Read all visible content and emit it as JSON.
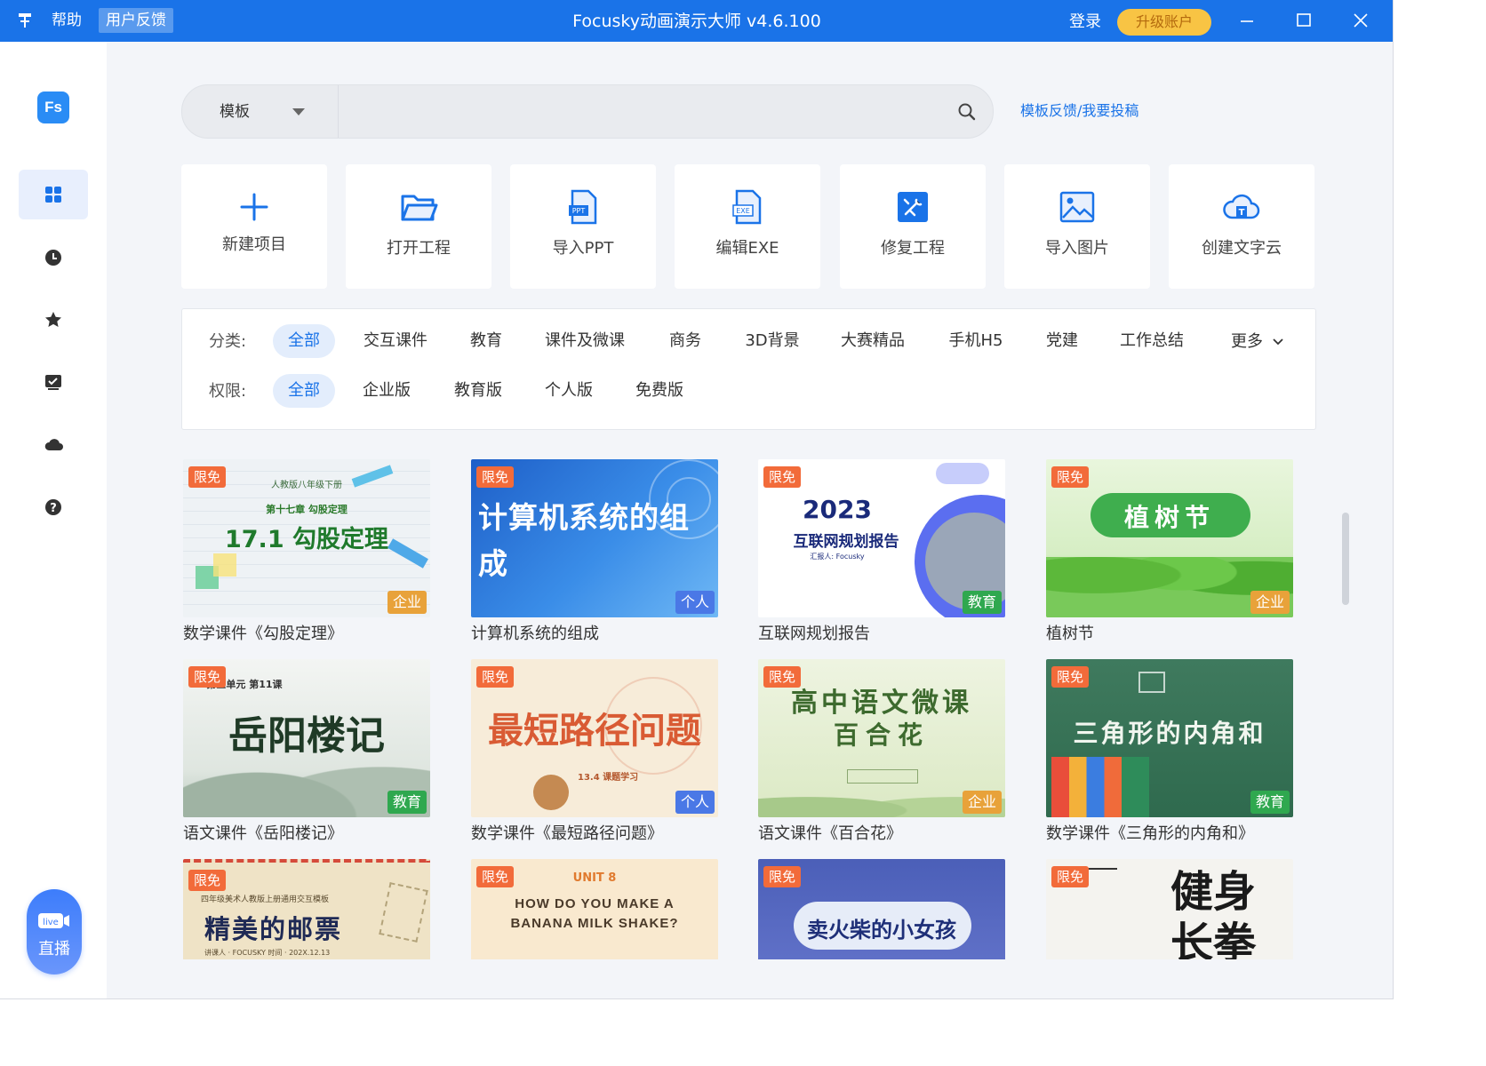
{
  "titlebar": {
    "menu_help": "帮助",
    "menu_feedback": "用户反馈",
    "title": "Focusky动画演示大师 v4.6.100",
    "login": "登录",
    "upgrade": "升级账户"
  },
  "sidebar": {
    "logo": "Fs",
    "live_badge": "live",
    "live_label": "直播"
  },
  "search": {
    "type_label": "模板",
    "placeholder": "",
    "feedback_link": "模板反馈/我要投稿"
  },
  "actions": [
    {
      "label": "新建项目",
      "icon": "plus-icon"
    },
    {
      "label": "打开工程",
      "icon": "folder-open-icon"
    },
    {
      "label": "导入PPT",
      "icon": "ppt-file-icon",
      "tag": "PPT"
    },
    {
      "label": "编辑EXE",
      "icon": "exe-file-icon",
      "tag": "EXE"
    },
    {
      "label": "修复工程",
      "icon": "repair-tools-icon"
    },
    {
      "label": "导入图片",
      "icon": "image-icon"
    },
    {
      "label": "创建文字云",
      "icon": "word-cloud-icon",
      "tag": "T"
    }
  ],
  "filters": {
    "category_label": "分类:",
    "categories": [
      "全部",
      "交互课件",
      "教育",
      "课件及微课",
      "商务",
      "3D背景",
      "大赛精品",
      "手机H5",
      "党建",
      "工作总结"
    ],
    "more": "更多",
    "permission_label": "权限:",
    "permissions": [
      "全部",
      "企业版",
      "教育版",
      "个人版",
      "免费版"
    ]
  },
  "templates": [
    {
      "name": "数学课件《勾股定理》",
      "free": "限免",
      "type": "企业",
      "thumb_title": "17.1 勾股定理",
      "thumb_sub": "第十七章 勾股定理",
      "thumb_top": "人教版八年级下册"
    },
    {
      "name": "计算机系统的组成",
      "free": "限免",
      "type": "个人",
      "thumb_title": "计算机系统的组成",
      "thumb_sub": "",
      "thumb_top": ""
    },
    {
      "name": "互联网规划报告",
      "free": "限免",
      "type": "教育",
      "thumb_title": "2023",
      "thumb_sub": "互联网规划报告",
      "thumb_top": "汇报人: Focusky"
    },
    {
      "name": "植树节",
      "free": "限免",
      "type": "企业",
      "thumb_title": "植树节",
      "thumb_sub": "",
      "thumb_top": ""
    },
    {
      "name": "语文课件《岳阳楼记》",
      "free": "限免",
      "type": "教育",
      "thumb_title": "岳阳楼记",
      "thumb_sub": "第三单元 第11课",
      "thumb_top": ""
    },
    {
      "name": "数学课件《最短路径问题》",
      "free": "限免",
      "type": "个人",
      "thumb_title": "最短路径问题",
      "thumb_sub": "13.4 课题学习",
      "thumb_top": ""
    },
    {
      "name": "语文课件《百合花》",
      "free": "限免",
      "type": "企业",
      "thumb_title": "高中语文微课",
      "thumb_sub": "百合花",
      "thumb_top": ""
    },
    {
      "name": "数学课件《三角形的内角和》",
      "free": "限免",
      "type": "教育",
      "thumb_title": "三角形的内角和",
      "thumb_sub": "",
      "thumb_top": ""
    },
    {
      "name": "",
      "free": "限免",
      "type": "",
      "thumb_title": "精美的邮票",
      "thumb_sub": "讲课人 · FOCUSKY    时间 · 202X.12.13",
      "thumb_top": "四年级美术人教版上册通用交互模板"
    },
    {
      "name": "",
      "free": "限免",
      "type": "",
      "thumb_title": "HOW DO YOU MAKE A BANANA MILK SHAKE?",
      "thumb_sub": "",
      "thumb_top": "UNIT 8"
    },
    {
      "name": "",
      "free": "限免",
      "type": "",
      "thumb_title": "卖火柴的小女孩",
      "thumb_sub": "",
      "thumb_top": ""
    },
    {
      "name": "",
      "free": "限免",
      "type": "",
      "thumb_title": "健身长拳",
      "thumb_sub": "",
      "thumb_top": ""
    }
  ],
  "colors": {
    "accent": "#1a73e8",
    "free_badge": "#f26b3a",
    "type_enterprise": "#e8a23a",
    "type_personal": "#4a78e6",
    "type_education": "#2fa84f"
  }
}
